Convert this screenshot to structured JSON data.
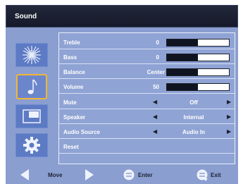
{
  "header": {
    "title": "Sound"
  },
  "sidebar": {
    "items": [
      {
        "icon": "brightness-icon",
        "selected": false
      },
      {
        "icon": "music-note-icon",
        "selected": true
      },
      {
        "icon": "screen-icon",
        "selected": false
      },
      {
        "icon": "gear-icon",
        "selected": false
      }
    ]
  },
  "menu": {
    "rows": [
      {
        "label": "Treble",
        "value": "0",
        "level": 0.5
      },
      {
        "label": "Bass",
        "value": "0",
        "level": 0.5
      },
      {
        "label": "Balance",
        "value": "Center",
        "level": 0.5
      },
      {
        "label": "Volume",
        "value": "50",
        "level": 0.5
      },
      {
        "label": "Mute",
        "value": "Off"
      },
      {
        "label": "Speaker",
        "value": "Internal"
      },
      {
        "label": "Audio Source",
        "value": "Audio In"
      },
      {
        "label": "Reset"
      }
    ]
  },
  "footer": {
    "move_label": "Move",
    "enter_label": "Enter",
    "exit_label": "Exit"
  },
  "colors": {
    "background": "#8a9ed0",
    "header": "#1a1e2e",
    "selected_border": "#f2b637",
    "menu_panel": "#8fa3d4"
  }
}
